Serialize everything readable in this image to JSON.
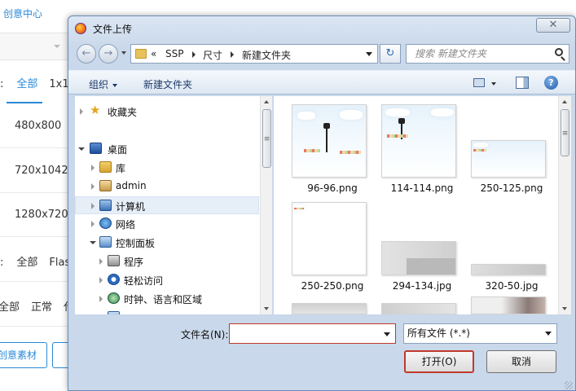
{
  "background_page": {
    "title": "创意中心",
    "filter_rows": [
      {
        "prefix": ":",
        "first": "全部",
        "second": "1x1"
      },
      {
        "prefix": ":",
        "first": "全部",
        "second": "Flas"
      },
      {
        "prefix": "",
        "first": "全部",
        "second": "正常",
        "third": "代"
      }
    ],
    "sizes": [
      "480x800",
      "720x1042",
      "1280x720"
    ],
    "button_label": "创意素材"
  },
  "dialog": {
    "title": "文件上传",
    "close_glyph": "✕",
    "nav": {
      "back_glyph": "←",
      "forward_glyph": "→",
      "breadcrumb_prefix": "«",
      "breadcrumb": [
        "SSP",
        "尺寸",
        "新建文件夹"
      ],
      "refresh_glyph": "↻",
      "search_placeholder": "搜索 新建文件夹"
    },
    "toolbar": {
      "organize": "组织",
      "new_folder": "新建文件夹",
      "help_glyph": "?"
    },
    "tree": [
      {
        "label": "收藏夹",
        "icon": "star-icon"
      },
      {
        "label": "桌面",
        "icon": "desktop-icon"
      },
      {
        "label": "库",
        "icon": "library-icon"
      },
      {
        "label": "admin",
        "icon": "user-folder-icon"
      },
      {
        "label": "计算机",
        "icon": "computer-icon"
      },
      {
        "label": "网络",
        "icon": "network-icon"
      },
      {
        "label": "控制面板",
        "icon": "control-panel-icon"
      },
      {
        "label": "程序",
        "icon": "programs-icon"
      },
      {
        "label": "轻松访问",
        "icon": "ease-of-access-icon"
      },
      {
        "label": "时钟、语言和区域",
        "icon": "clock-region-icon"
      }
    ],
    "files": [
      {
        "name": "96-96.png"
      },
      {
        "name": "114-114.png"
      },
      {
        "name": "250-125.png"
      },
      {
        "name": "250-250.png"
      },
      {
        "name": "294-134.jpg"
      },
      {
        "name": "320-50.jpg"
      }
    ],
    "bottom": {
      "filename_label": "文件名(N):",
      "filename_value": "",
      "filetype_value": "所有文件 (*.*)",
      "open_button": "打开(O)",
      "cancel_button": "取消"
    }
  }
}
